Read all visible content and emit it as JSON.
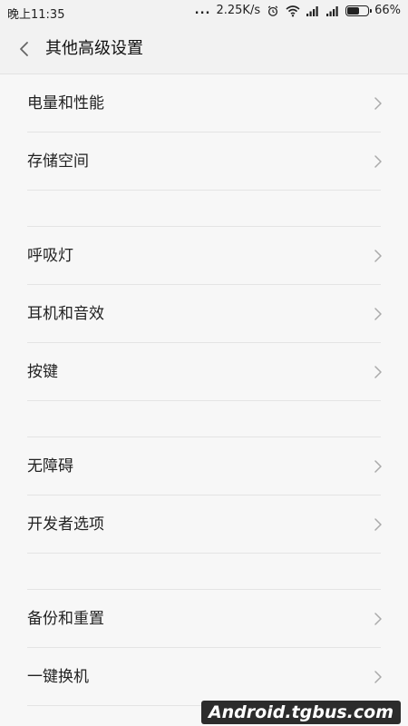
{
  "status_bar": {
    "time": "晚上11:35",
    "dots": "...",
    "speed": "2.25K/s",
    "battery_percent": "66%",
    "battery_level": 0.66,
    "icons": [
      "alarm-icon",
      "wifi-icon",
      "signal-icon",
      "signal-icon",
      "battery-icon"
    ]
  },
  "header": {
    "title": "其他高级设置",
    "back_icon": "chevron-left-icon"
  },
  "groups": [
    {
      "items": [
        {
          "label": "电量和性能"
        },
        {
          "label": "存储空间"
        }
      ]
    },
    {
      "items": [
        {
          "label": "呼吸灯"
        },
        {
          "label": "耳机和音效"
        },
        {
          "label": "按键"
        }
      ]
    },
    {
      "items": [
        {
          "label": "无障碍"
        },
        {
          "label": "开发者选项"
        }
      ]
    },
    {
      "items": [
        {
          "label": "备份和重置"
        },
        {
          "label": "一键换机"
        }
      ]
    }
  ],
  "watermark": {
    "text": "Android.tgbus.com"
  }
}
